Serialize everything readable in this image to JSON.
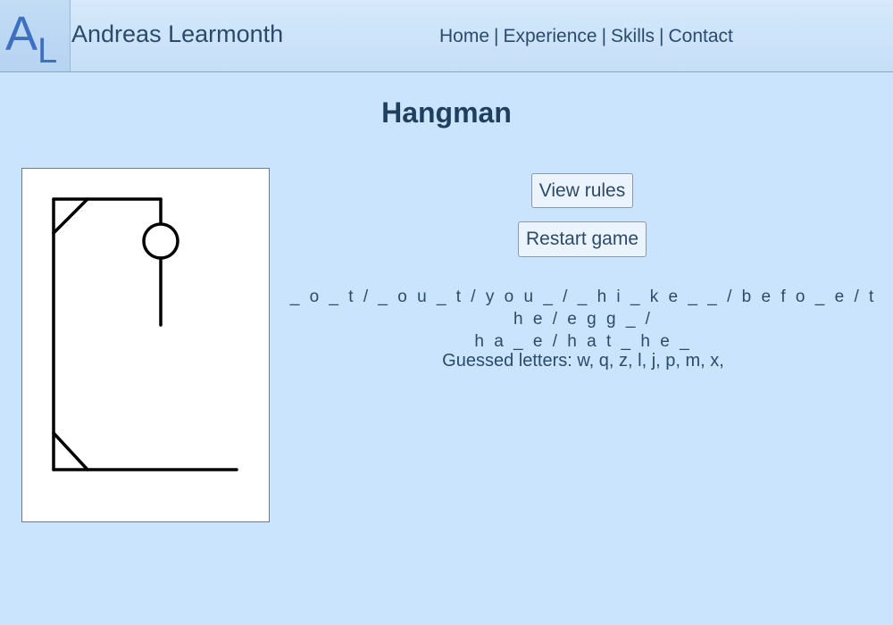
{
  "header": {
    "logo_text": "AL",
    "site_name": "Andreas Learmonth",
    "nav": {
      "home": "Home",
      "experience": "Experience",
      "skills": "Skills",
      "contact": "Contact",
      "separator": "|"
    }
  },
  "main": {
    "title": "Hangman",
    "view_rules_label": "View rules",
    "restart_label": "Restart game",
    "puzzle_line1": "_ o _ t / _ o u _ t / y o u _ / _ h i _ k e _ _ / b e f o _ e / t h e / e g g _ /",
    "puzzle_line2": "h a _ e / h a t _ h e _",
    "guessed_label": "Guessed letters:",
    "guessed_letters": "w, q, z, l, j, p, m, x,"
  },
  "hangman": {
    "wrong_guesses": 8,
    "parts_shown": [
      "base",
      "left-post",
      "bottom-brace",
      "top-beam",
      "top-brace",
      "rope",
      "head",
      "body"
    ]
  }
}
